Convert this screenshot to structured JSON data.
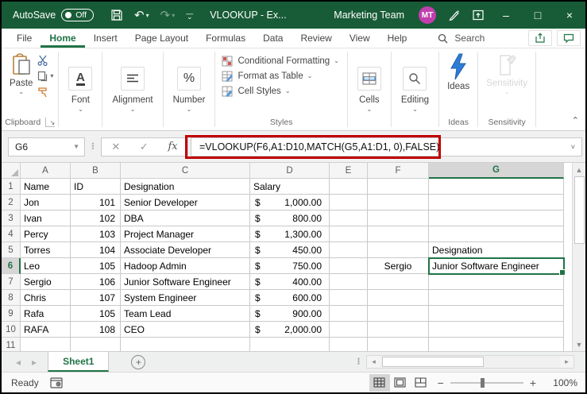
{
  "titlebar": {
    "autosave_label": "AutoSave",
    "autosave_state": "Off",
    "title": "VLOOKUP  -  Ex...",
    "team": "Marketing Team",
    "avatar_initials": "MT",
    "minimize": "–",
    "maximize": "□",
    "close": "×"
  },
  "tabs": {
    "items": [
      "File",
      "Home",
      "Insert",
      "Page Layout",
      "Formulas",
      "Data",
      "Review",
      "View",
      "Help"
    ],
    "active": "Home",
    "search_label": "Search"
  },
  "ribbon": {
    "paste_label": "Paste",
    "clipboard_group": "Clipboard",
    "font_label": "Font",
    "alignment_label": "Alignment",
    "number_label": "Number",
    "number_glyph": "%",
    "styles": {
      "items": [
        "Conditional Formatting",
        "Format as Table",
        "Cell Styles"
      ],
      "group": "Styles"
    },
    "cells_label": "Cells",
    "editing_label": "Editing",
    "ideas_label": "Ideas",
    "ideas_group": "Ideas",
    "sensitivity_label": "Sensitivity",
    "sensitivity_group": "Sensitivity"
  },
  "formula_bar": {
    "name_box": "G6",
    "cancel_glyph": "✕",
    "enter_glyph": "✓",
    "fx_label": "fx",
    "formula": "=VLOOKUP(F6,A1:D10,MATCH(G5,A1:D1, 0),FALSE)"
  },
  "sheet": {
    "columns": [
      "A",
      "B",
      "C",
      "D",
      "E",
      "F",
      "G"
    ],
    "currency": "$",
    "selected_cell": "G6",
    "selected_column": "G",
    "selected_row": 6,
    "rows": [
      {
        "n": 1,
        "a": "Name",
        "b": "ID",
        "c": "Designation",
        "d": "Salary",
        "header": true
      },
      {
        "n": 2,
        "a": "Jon",
        "b": "101",
        "c": "Senior Developer",
        "amt": "1,000.00"
      },
      {
        "n": 3,
        "a": "Ivan",
        "b": "102",
        "c": "DBA",
        "amt": "800.00"
      },
      {
        "n": 4,
        "a": "Percy",
        "b": "103",
        "c": "Project Manager",
        "amt": "1,300.00"
      },
      {
        "n": 5,
        "a": "Torres",
        "b": "104",
        "c": "Associate Developer",
        "amt": "450.00",
        "g": "Designation"
      },
      {
        "n": 6,
        "a": "Leo",
        "b": "105",
        "c": "Hadoop Admin",
        "amt": "750.00",
        "f": "Sergio",
        "g": "Junior Software Engineer",
        "selected": true
      },
      {
        "n": 7,
        "a": "Sergio",
        "b": "106",
        "c": "Junior Software Engineer",
        "amt": "400.00"
      },
      {
        "n": 8,
        "a": "Chris",
        "b": "107",
        "c": "System Engineer",
        "amt": "600.00"
      },
      {
        "n": 9,
        "a": "Rafa",
        "b": "105",
        "c": "Team Lead",
        "amt": "900.00"
      },
      {
        "n": 10,
        "a": "RAFA",
        "b": "108",
        "c": "CEO",
        "amt": "2,000.00"
      },
      {
        "n": 11
      }
    ]
  },
  "sheet_tabs": {
    "active": "Sheet1",
    "add_glyph": "+"
  },
  "status_bar": {
    "mode": "Ready",
    "zoom_level": "100%"
  },
  "colors": {
    "title_green": "#185C37",
    "accent_green": "#217346",
    "annotation_red": "#C00000",
    "avatar_magenta": "#C13FAE",
    "ideas_blue": "#2E7CD6"
  }
}
